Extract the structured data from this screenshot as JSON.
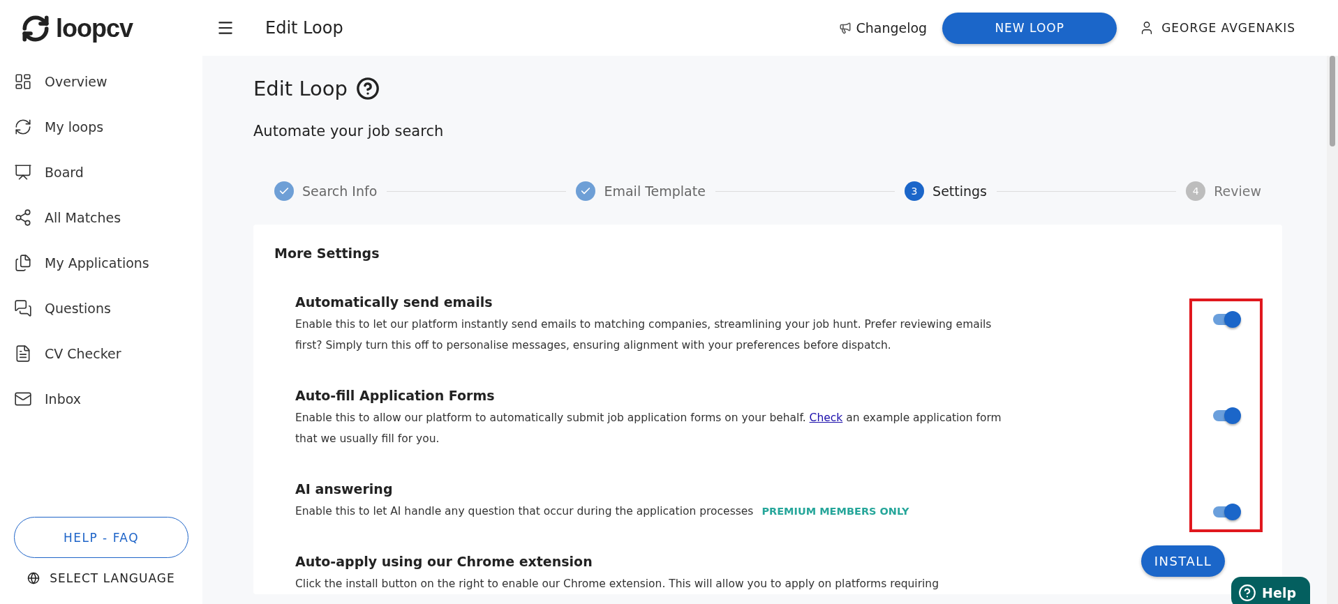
{
  "brand": {
    "name": "loopcv"
  },
  "sidebar": {
    "items": [
      {
        "label": "Overview",
        "selected": false
      },
      {
        "label": "My loops",
        "selected": false
      },
      {
        "label": "Board",
        "selected": false
      },
      {
        "label": "All Matches",
        "selected": false
      },
      {
        "label": "My Applications",
        "selected": false
      },
      {
        "label": "Questions",
        "selected": false
      },
      {
        "label": "CV Checker",
        "selected": false
      },
      {
        "label": "Inbox",
        "selected": false
      }
    ],
    "help_button": "HELP - FAQ",
    "language": "SELECT LANGUAGE"
  },
  "topbar": {
    "title": "Edit Loop",
    "changelog": "Changelog",
    "new_button": "NEW LOOP",
    "user": "GEORGE AVGENAKIS"
  },
  "page": {
    "title": "Edit Loop",
    "subtitle": "Automate your job search"
  },
  "steps": [
    {
      "label": "Search Info",
      "completed": true,
      "selected": false
    },
    {
      "label": "Email Template",
      "completed": true,
      "selected": false
    },
    {
      "number": "3",
      "label": "Settings",
      "completed": false,
      "selected": true
    },
    {
      "number": "4",
      "label": "Review",
      "completed": false,
      "selected": false
    }
  ],
  "settings": {
    "heading": "More Settings",
    "highlight": true,
    "rows": [
      {
        "kind": "toggle",
        "title": "Automatically send emails",
        "description": "Enable this to let our platform instantly send emails to matching companies, streamlining your job hunt. Prefer reviewing emails first? Simply turn this off to personalise messages, ensuring alignment with your preferences before dispatch.",
        "on": true
      },
      {
        "kind": "toggle",
        "title": "Auto-fill Application Forms",
        "description": "Enable this to allow our platform to automatically submit job application forms on your behalf.",
        "link": "Check",
        "description_after": "an example application form that we usually fill for you.",
        "on": true
      },
      {
        "kind": "toggle",
        "title": "AI answering",
        "description": "Enable this to let AI handle any question that occur during the application processes",
        "badge": "PREMIUM MEMBERS ONLY",
        "on": true
      },
      {
        "kind": "install",
        "title": "Auto-apply using our Chrome extension",
        "description": "Click the install button on the right to enable our Chrome extension. This will allow you to apply on platforms requiring",
        "button": "INSTALL"
      }
    ]
  },
  "help_widget": {
    "label": "Help"
  }
}
